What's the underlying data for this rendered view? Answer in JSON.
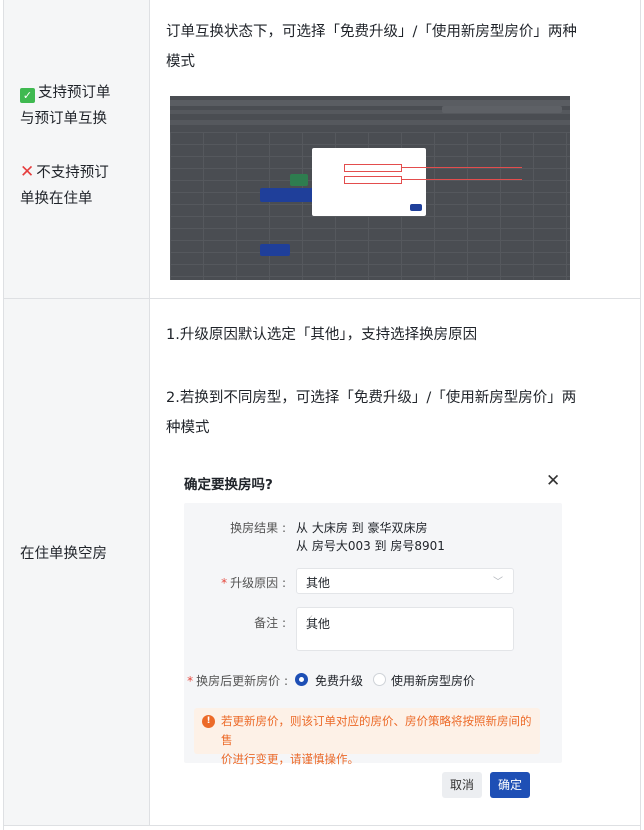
{
  "row1": {
    "label_support_line1": "支持预订单",
    "label_support_line2": "与预订单互换",
    "label_nosupport_line1": "不支持预订",
    "label_nosupport_line2": "单换在住单",
    "desc_line1": "订单互换状态下，可选择「免费升级」/「使用新房型房价」两种",
    "desc_line2": "模式"
  },
  "row2": {
    "label": "在住单换空房",
    "p1": "1.升级原因默认选定「其他」，支持选择换房原因",
    "p2_line1": "2.若换到不同房型，可选择「免费升级」/「使用新房型房价」两",
    "p2_line2": "种模式"
  },
  "dialog": {
    "title": "确定要换房吗?",
    "result_label": "换房结果 :",
    "result_line1": "从 大床房 到 豪华双床房",
    "result_line2": "从 房号大003 到 房号8901",
    "reason_label": "升级原因 :",
    "reason_value": "其他",
    "note_label": "备注 :",
    "note_value": "其他",
    "price_label": "换房后更新房价 :",
    "option_free": "免费升级",
    "option_new": "使用新房型房价",
    "warning_line1": "若更新房价，则该订单对应的房价、房价策略将按照新房间的售",
    "warning_line2": "价进行变更，请谨慎操作。",
    "cancel": "取消",
    "confirm": "确定"
  },
  "colors": {
    "primary": "#1e4fb5",
    "warning": "#ec6a28",
    "required": "#e5483d"
  }
}
